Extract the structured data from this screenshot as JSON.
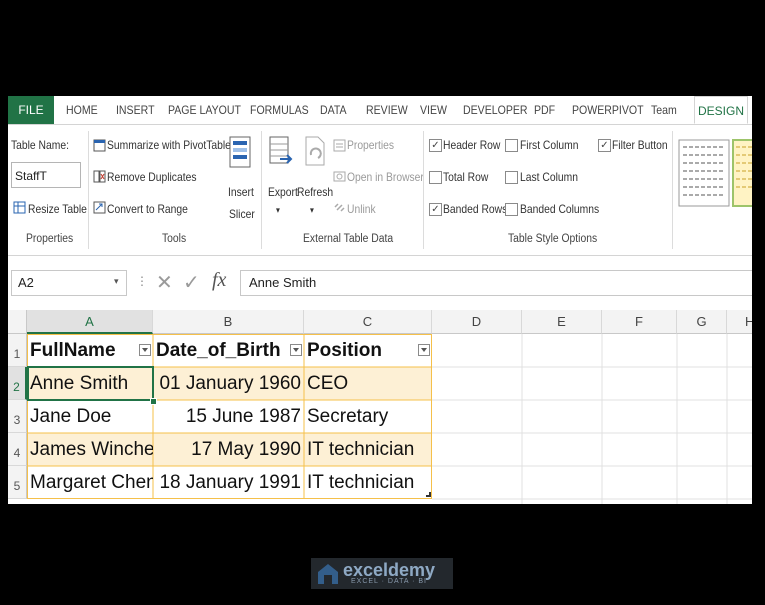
{
  "ribbon_tabs": [
    "FILE",
    "HOME",
    "INSERT",
    "PAGE LAYOUT",
    "FORMULAS",
    "DATA",
    "REVIEW",
    "VIEW",
    "DEVELOPER",
    "PDF",
    "POWERPIVOT",
    "Team",
    "DESIGN"
  ],
  "properties": {
    "table_name_label": "Table Name:",
    "table_name_value": "StaffT",
    "resize_table": "Resize Table",
    "group_label": "Properties"
  },
  "tools": {
    "summarize_pivot": "Summarize with PivotTable",
    "remove_duplicates": "Remove Duplicates",
    "convert_to_range": "Convert to Range",
    "insert_slicer_1": "Insert",
    "insert_slicer_2": "Slicer",
    "group_label": "Tools"
  },
  "external": {
    "export": "Export",
    "refresh": "Refresh",
    "properties": "Properties",
    "open_in_browser": "Open in Browser",
    "unlink": "Unlink",
    "group_label": "External Table Data"
  },
  "style_options": {
    "header_row": "Header Row",
    "total_row": "Total Row",
    "banded_rows": "Banded Rows",
    "first_column": "First Column",
    "last_column": "Last Column",
    "banded_columns": "Banded Columns",
    "filter_button": "Filter Button",
    "group_label": "Table Style Options",
    "header_row_checked": true,
    "total_row_checked": false,
    "banded_rows_checked": true,
    "first_column_checked": false,
    "last_column_checked": false,
    "banded_columns_checked": false,
    "filter_button_checked": true
  },
  "formula_bar": {
    "name_box": "A2",
    "cancel_symbol": "✕",
    "enter_symbol": "✓",
    "fx": "fx",
    "content": "Anne Smith"
  },
  "sheet": {
    "columns": [
      "A",
      "B",
      "C",
      "D",
      "E",
      "F",
      "G",
      "H"
    ],
    "rows": [
      "1",
      "2",
      "3",
      "4",
      "5"
    ],
    "headers": [
      "FullName",
      "Date_of_Birth",
      "Position"
    ],
    "data": [
      [
        "Anne Smith",
        "01 January 1960",
        "CEO"
      ],
      [
        "Jane Doe",
        "15 June 1987",
        "Secretary"
      ],
      [
        "James Winchester",
        "17 May 1990",
        "IT technician"
      ],
      [
        "Margaret Chen",
        "18 January 1991",
        "IT technician"
      ]
    ]
  },
  "watermark": {
    "title": "exceldemy",
    "subtitle": "EXCEL · DATA · BI"
  },
  "colors": {
    "excel_green": "#217346",
    "band": "#fdf0d5",
    "table_border": "#f5c04a"
  }
}
